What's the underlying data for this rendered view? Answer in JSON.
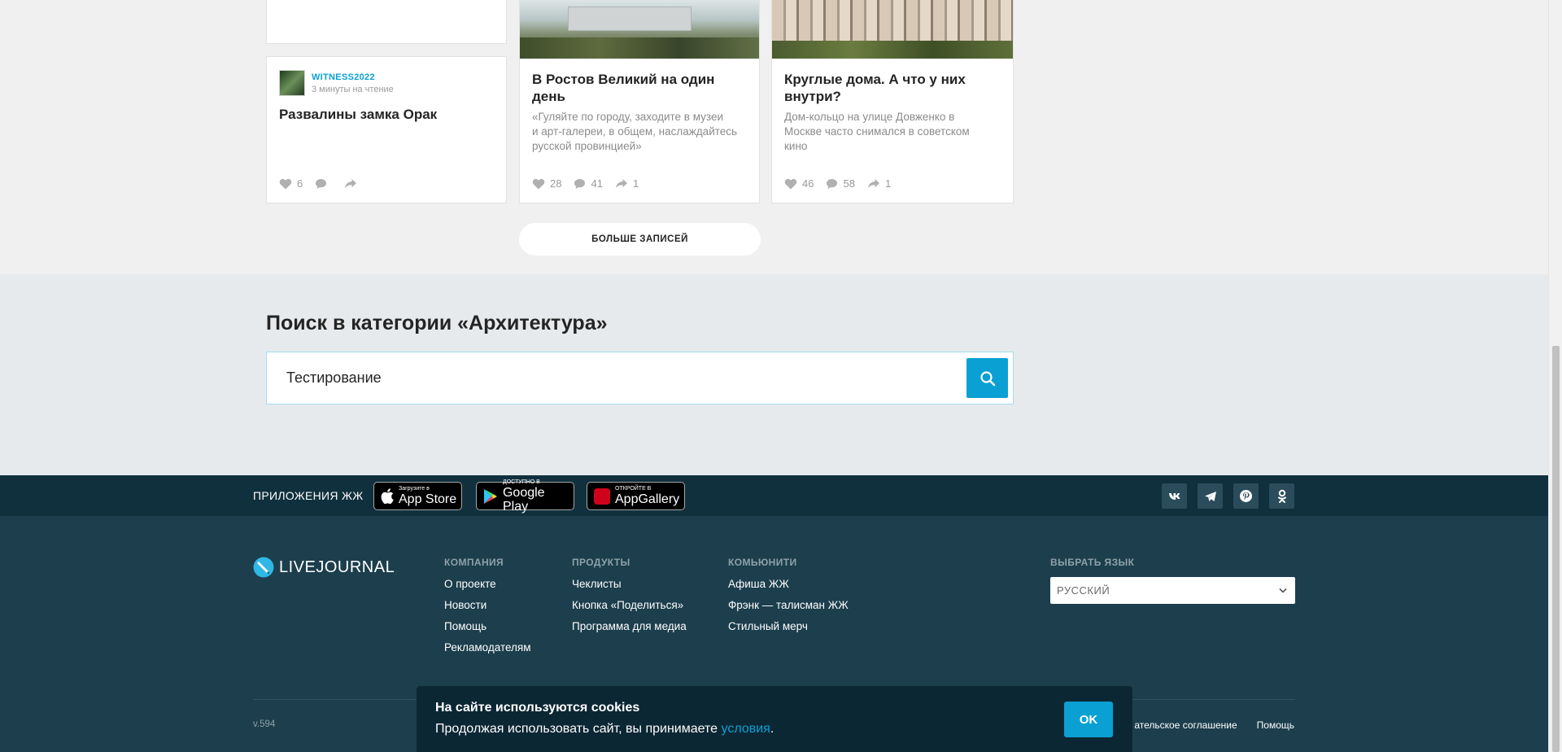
{
  "cards": [
    {
      "author": "WITNESS2022",
      "read_time": "3 минуты на чтение",
      "title": "Развалины замка Орак",
      "likes": "6"
    },
    {
      "title_line1": "В Ростов Великий на один",
      "title_line2": "день",
      "excerpt_line1": "«Гуляйте по городу, заходите в музеи",
      "excerpt_line2": "и арт-галереи, в общем, наслаждайтесь",
      "excerpt_line3": "русской провинцией»",
      "likes": "28",
      "comments": "41",
      "shares": "1"
    },
    {
      "title_line1": "Круглые дома. А что у них",
      "title_line2": "внутри?",
      "excerpt_line1": "Дом-кольцо на улице Довженко в",
      "excerpt_line2": "Москве часто снимался в советском",
      "excerpt_line3": "кино",
      "likes": "46",
      "comments": "58",
      "shares": "1"
    }
  ],
  "more_button": "БОЛЬШЕ ЗАПИСЕЙ",
  "search": {
    "title": "Поиск в категории «Архитектура»",
    "value": "Тестирование"
  },
  "apps": {
    "label": "ПРИЛОЖЕНИЯ ЖЖ",
    "appstore_small": "Загрузите в",
    "appstore_big": "App Store",
    "googleplay_small": "ДОСТУПНО В",
    "googleplay_big": "Google Play",
    "appgallery_small": "ОТКРОЙТЕ В",
    "appgallery_big": "AppGallery"
  },
  "footer": {
    "logo": "LIVEJOURNAL",
    "company": {
      "heading": "КОМПАНИЯ",
      "links": [
        "О проекте",
        "Новости",
        "Помощь",
        "Рекламодателям"
      ]
    },
    "products": {
      "heading": "ПРОДУКТЫ",
      "links": [
        "Чеклисты",
        "Кнопка «Поделиться»",
        "Программа для медиа"
      ]
    },
    "community": {
      "heading": "КОМЬЮНИТИ",
      "links": [
        "Афиша ЖЖ",
        "Фрэнк — талисман ЖЖ",
        "Стильный мерч"
      ]
    },
    "language": {
      "heading": "ВЫБРАТЬ ЯЗЫК",
      "selected": "РУССКИЙ"
    },
    "version": "v.594",
    "bottom_links": [
      "ательское соглашение",
      "Помощь"
    ]
  },
  "cookie": {
    "title": "На сайте используются cookies",
    "text": "Продолжая использовать сайт, вы принимаете",
    "link": "условия",
    "after_link": ".",
    "ok": "OK"
  },
  "colors": {
    "accent": "#0aa0d3",
    "footer_bg": "#1c3e4d",
    "apps_bg": "#10303d",
    "cookie_bg": "#0c2734"
  }
}
